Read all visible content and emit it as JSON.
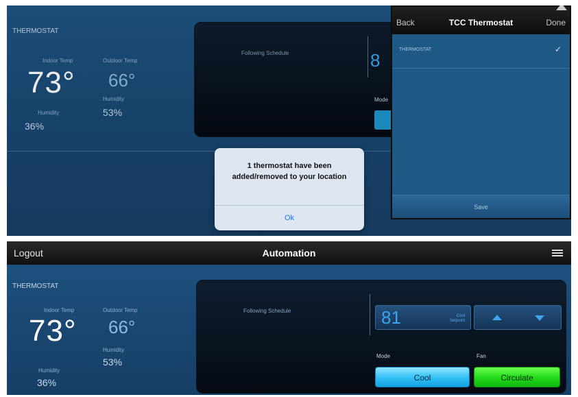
{
  "top": {
    "thermostat_label": "THERMOSTAT",
    "indoor_label": "Indoor Temp",
    "indoor_temp": "73°",
    "outdoor_label": "Outdoor Temp",
    "outdoor_temp": "66°",
    "humidity_label": "Humidity",
    "indoor_humidity": "36%",
    "outdoor_humidity_label": "Humidity",
    "outdoor_humidity": "53%",
    "schedule_status": "Following Schedule",
    "setpoint_partial": "8",
    "mode_partial": "Mode",
    "popover": {
      "back": "Back",
      "title": "TCC Thermostat",
      "done": "Done",
      "item": "THERMOSTAT",
      "check": "✓",
      "save": "Save"
    },
    "alert": {
      "message": "1 thermostat have been added/removed to your location",
      "ok": "Ok"
    }
  },
  "bottom": {
    "logout": "Logout",
    "title": "Automation",
    "thermostat_label": "THERMOSTAT",
    "indoor_label": "Indoor Temp",
    "indoor_temp": "73°",
    "outdoor_label": "Outdoor Temp",
    "outdoor_temp": "66°",
    "humidity_label": "Humidity",
    "indoor_humidity": "36%",
    "outdoor_humidity_label": "Humidity",
    "outdoor_humidity": "53%",
    "schedule_status": "Following Schedule",
    "setpoint": "81",
    "setpoint_sub": "Cool Setpoint",
    "mode_label": "Mode",
    "mode_value": "Cool",
    "fan_label": "Fan",
    "fan_value": "Circulate"
  },
  "colors": {
    "background_blue": "#1d4e78",
    "cool_button": "#2fbef6",
    "circulate_button": "#1fd81a",
    "setpoint_text": "#3ea4ee",
    "alert_link": "#1877e6"
  }
}
